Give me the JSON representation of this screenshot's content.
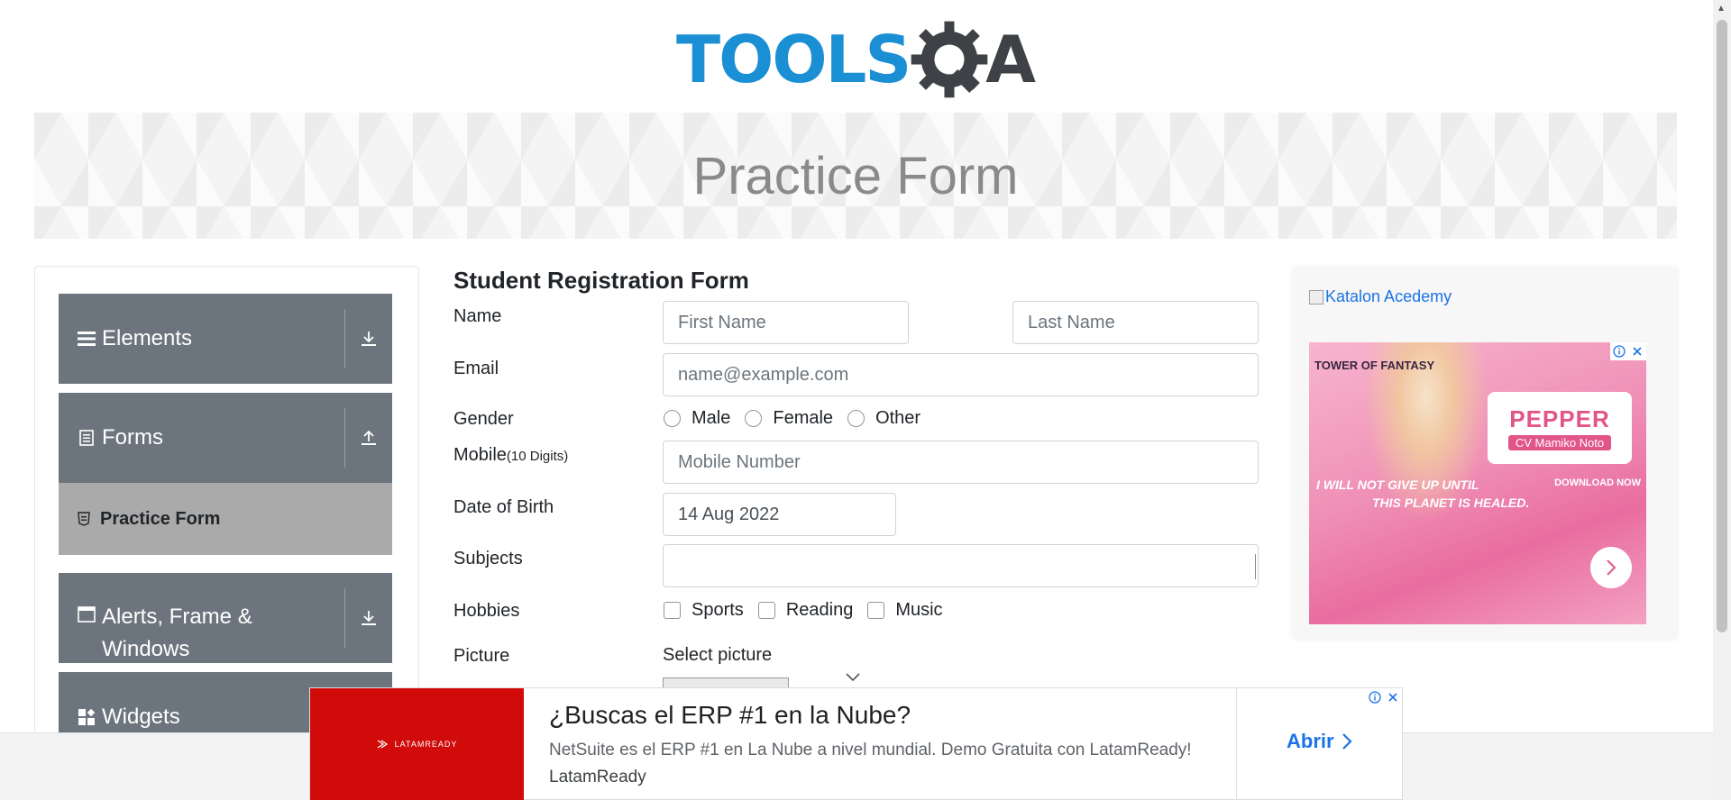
{
  "header": {
    "logo_text": "TOOLS",
    "logo_tail": "A"
  },
  "banner": {
    "title": "Practice Form"
  },
  "sidebar": {
    "groups": [
      {
        "label": "Elements",
        "icon": "hamburger-icon",
        "state": "collapsed"
      },
      {
        "label": "Forms",
        "icon": "document-icon",
        "state": "expanded"
      },
      {
        "label": "Alerts, Frame &",
        "label_line2": "Windows",
        "icon": "window-icon",
        "state": "collapsed"
      },
      {
        "label": "Widgets",
        "icon": "widgets-icon",
        "state": "collapsed"
      }
    ],
    "active_item": "Practice Form"
  },
  "form": {
    "heading": "Student Registration Form",
    "name_label": "Name",
    "first_name_placeholder": "First Name",
    "last_name_placeholder": "Last Name",
    "email_label": "Email",
    "email_placeholder": "name@example.com",
    "gender_label": "Gender",
    "gender_options": [
      "Male",
      "Female",
      "Other"
    ],
    "mobile_label": "Mobile",
    "mobile_hint": "(10 Digits)",
    "mobile_placeholder": "Mobile Number",
    "dob_label": "Date of Birth",
    "dob_value": "14 Aug 2022",
    "subjects_label": "Subjects",
    "hobbies_label": "Hobbies",
    "hobby_options": [
      "Sports",
      "Reading",
      "Music"
    ],
    "picture_label": "Picture",
    "picture_button": "Select picture"
  },
  "right_ad": {
    "link_text": "Katalon Acedemy",
    "brand": "TOWER OF FANTASY",
    "headline": "PEPPER",
    "sub": "CV Mamiko Noto",
    "tagline_1": "I WILL NOT GIVE UP UNTIL",
    "tagline_2": "THIS PLANET IS HEALED.",
    "download": "DOWNLOAD NOW"
  },
  "bottom_ad": {
    "logo_text": "LATAMREADY",
    "title": "¿Buscas el ERP #1 en la Nube?",
    "description": "NetSuite es el ERP #1 en La Nube a nivel mundial. Demo Gratuita con LatamReady!",
    "brand": "LatamReady",
    "cta": "Abrir"
  },
  "colors": {
    "logo_blue": "#1b8fd4",
    "logo_dark": "#3e4145",
    "sidebar_group": "#6c757d",
    "sidebar_active": "#aaaaaa",
    "ad_red": "#d10a0a",
    "link_blue": "#1a73e8"
  }
}
